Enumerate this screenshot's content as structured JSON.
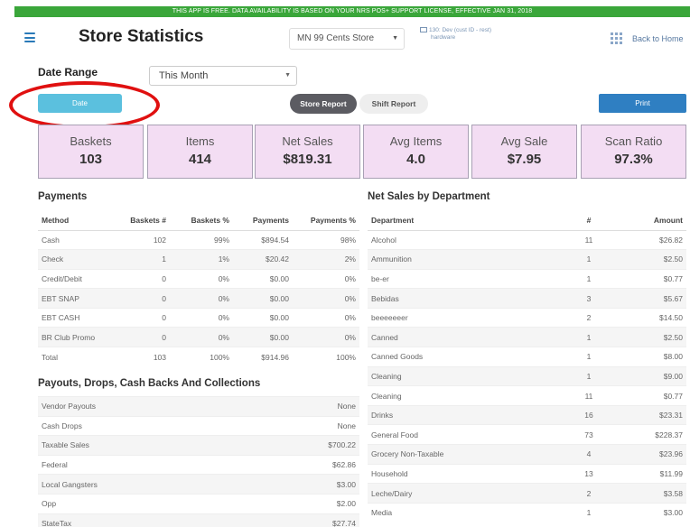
{
  "banner": {
    "text": "THIS APP IS FREE. DATA AVAILABILITY IS BASED ON YOUR NRS POS+ SUPPORT LICENSE, EFFECTIVE JAN 31, 2018"
  },
  "header": {
    "title": "Store Statistics",
    "store_select": "MN 99 Cents Store",
    "device_line1": "130: Dev (cust ID - rest)",
    "device_line2": "hardware",
    "back_home": "Back to Home"
  },
  "filters": {
    "date_range_label": "Date Range",
    "date_range_value": "This Month",
    "date_button": "Date",
    "store_report": "Store Report",
    "shift_report": "Shift Report",
    "print": "Print"
  },
  "stats": [
    {
      "label": "Baskets",
      "value": "103"
    },
    {
      "label": "Items",
      "value": "414"
    },
    {
      "label": "Net Sales",
      "value": "$819.31"
    },
    {
      "label": "Avg Items",
      "value": "4.0"
    },
    {
      "label": "Avg Sale",
      "value": "$7.95"
    },
    {
      "label": "Scan Ratio",
      "value": "97.3%"
    }
  ],
  "payments": {
    "title": "Payments",
    "headers": [
      "Method",
      "Baskets #",
      "Baskets %",
      "Payments",
      "Payments %"
    ],
    "rows": [
      [
        "Cash",
        "102",
        "99%",
        "$894.54",
        "98%"
      ],
      [
        "Check",
        "1",
        "1%",
        "$20.42",
        "2%"
      ],
      [
        "Credit/Debit",
        "0",
        "0%",
        "$0.00",
        "0%"
      ],
      [
        "EBT SNAP",
        "0",
        "0%",
        "$0.00",
        "0%"
      ],
      [
        "EBT CASH",
        "0",
        "0%",
        "$0.00",
        "0%"
      ],
      [
        "BR Club Promo",
        "0",
        "0%",
        "$0.00",
        "0%"
      ],
      [
        "Total",
        "103",
        "100%",
        "$914.96",
        "100%"
      ]
    ]
  },
  "payouts": {
    "title": "Payouts, Drops, Cash Backs And Collections",
    "rows": [
      [
        "Vendor Payouts",
        "None"
      ],
      [
        "Cash Drops",
        "None"
      ],
      [
        "Taxable Sales",
        "$700.22"
      ],
      [
        "Federal",
        "$62.86"
      ],
      [
        "Local Gangsters",
        "$3.00"
      ],
      [
        "Opp",
        "$2.00"
      ],
      [
        "StateTax",
        "$27.74"
      ]
    ]
  },
  "departments": {
    "title": "Net Sales by Department",
    "headers": [
      "Department",
      "#",
      "Amount"
    ],
    "rows": [
      [
        "Alcohol",
        "11",
        "$26.82"
      ],
      [
        "Ammunition",
        "1",
        "$2.50"
      ],
      [
        "be-er",
        "1",
        "$0.77"
      ],
      [
        "Bebidas",
        "3",
        "$5.67"
      ],
      [
        "beeeeeeer",
        "2",
        "$14.50"
      ],
      [
        "Canned",
        "1",
        "$2.50"
      ],
      [
        "Canned Goods",
        "1",
        "$8.00"
      ],
      [
        "Cleaning",
        "1",
        "$9.00"
      ],
      [
        "Cleaning",
        "11",
        "$0.77"
      ],
      [
        "Drinks",
        "16",
        "$23.31"
      ],
      [
        "General Food",
        "73",
        "$228.37"
      ],
      [
        "Grocery Non-Taxable",
        "4",
        "$23.96"
      ],
      [
        "Household",
        "13",
        "$11.99"
      ],
      [
        "Leche/Dairy",
        "2",
        "$3.58"
      ],
      [
        "Media",
        "1",
        "$3.00"
      ]
    ]
  }
}
